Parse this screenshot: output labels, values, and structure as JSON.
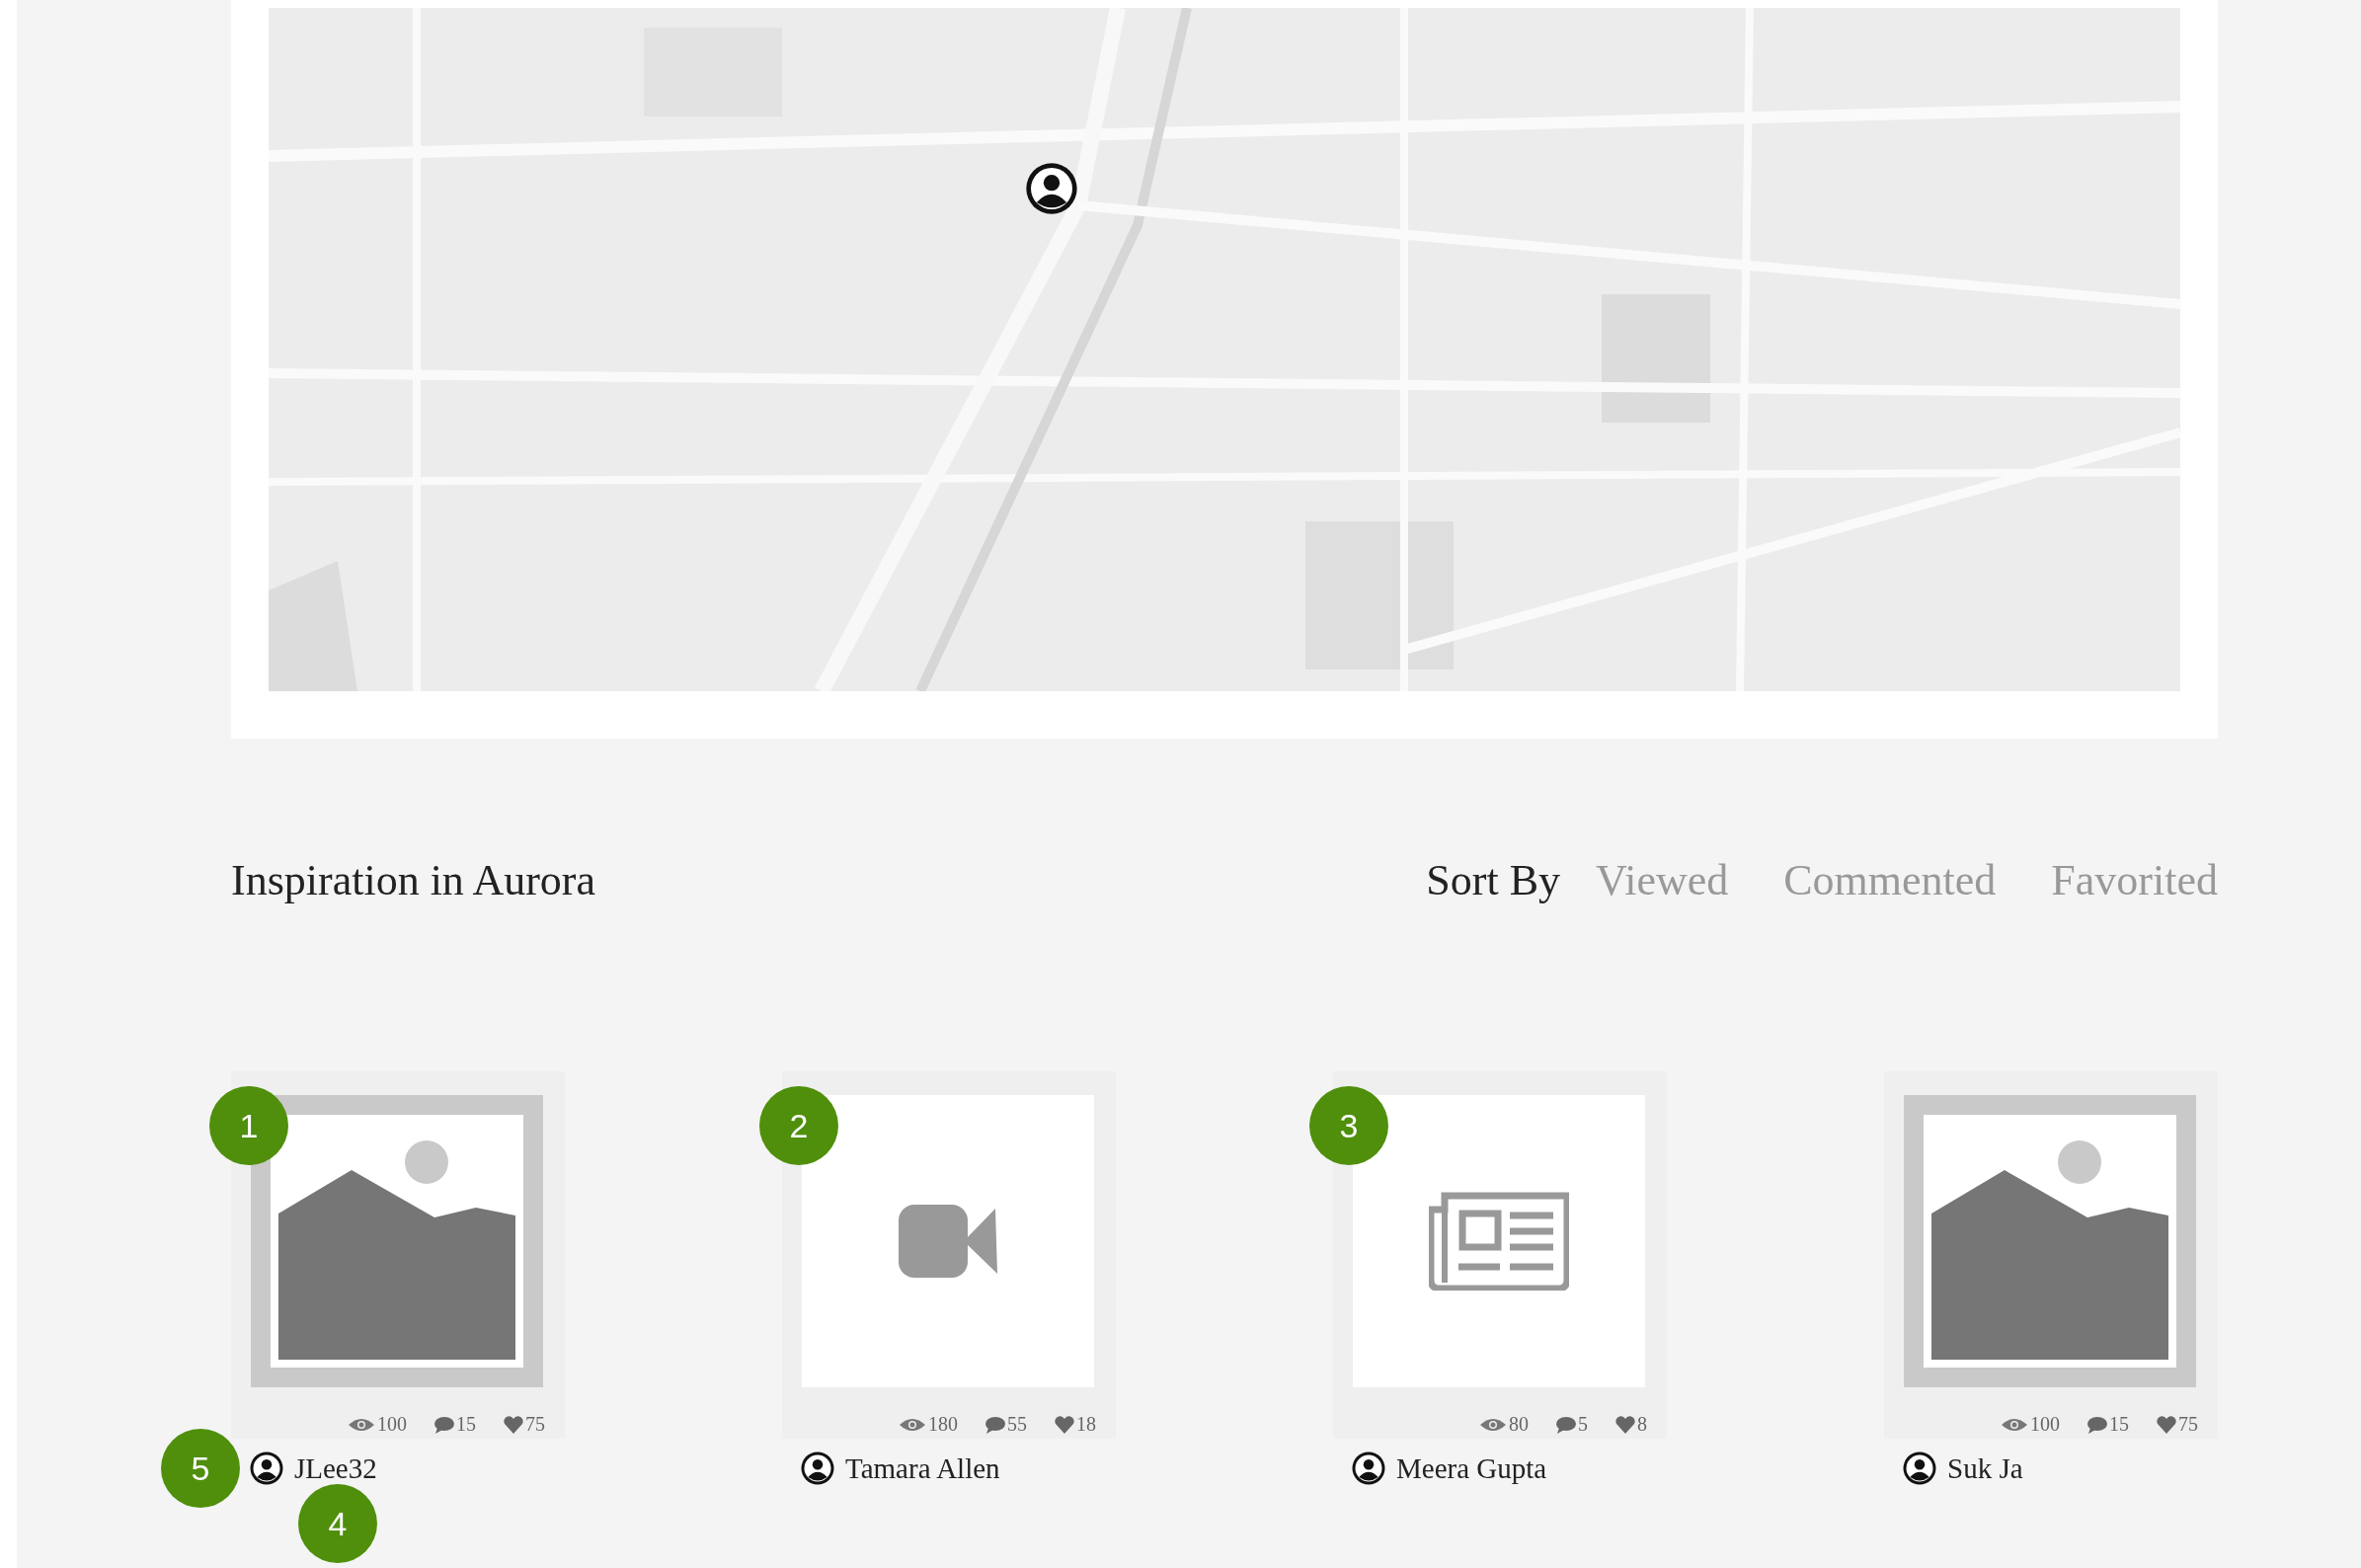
{
  "section": {
    "title": "Inspiration in Aurora",
    "sort_label": "Sort By",
    "sort_options": [
      {
        "label": "Viewed",
        "selected": false
      },
      {
        "label": "Commented",
        "selected": false
      },
      {
        "label": "Favorited",
        "selected": false
      }
    ]
  },
  "cards": [
    {
      "views": "100",
      "comments": "15",
      "likes": "75",
      "author": "JLee32"
    },
    {
      "kind": "video",
      "views": "180",
      "comments": "55",
      "likes": "18",
      "author": "Tamara Allen"
    },
    {
      "kind": "article",
      "views": "80",
      "comments": "5",
      "likes": "8",
      "author": "Meera Gupta"
    },
    {
      "views": "100",
      "comments": "15",
      "likes": "75",
      "author": "Suk Ja"
    }
  ],
  "markers": [
    "1",
    "2",
    "3",
    "5",
    "4"
  ]
}
